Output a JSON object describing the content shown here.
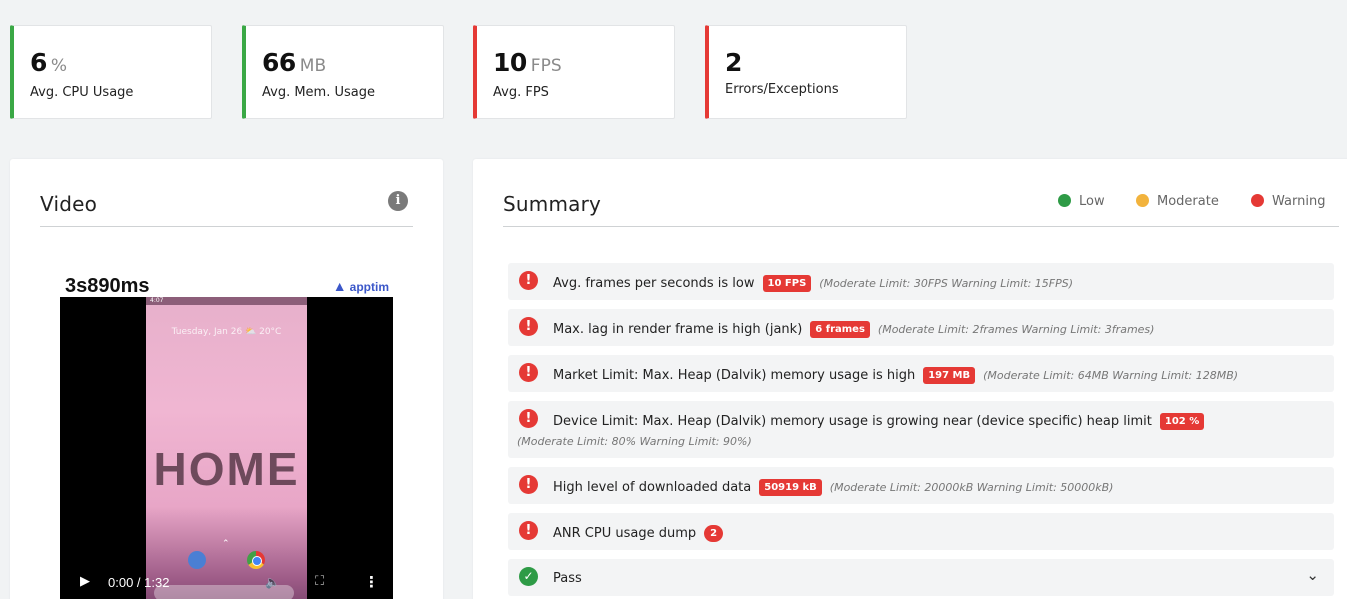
{
  "metrics": [
    {
      "value": "6",
      "unit": "%",
      "label": "Avg. CPU Usage",
      "status": "green"
    },
    {
      "value": "66",
      "unit": "MB",
      "label": "Avg. Mem. Usage",
      "status": "green"
    },
    {
      "value": "10",
      "unit": "FPS",
      "label": "Avg. FPS",
      "status": "red"
    },
    {
      "value": "2",
      "unit": "",
      "label": "Errors/Exceptions",
      "status": "red"
    }
  ],
  "video": {
    "title": "Video",
    "info_icon": "info-icon",
    "overlay_timer": "3s890ms",
    "brand": "apptim",
    "screen_text": "HOME",
    "date_text": "Tuesday, Jan 26 ⛅ 20°C",
    "status_time": "4:07",
    "time": "0:00 / 1:32"
  },
  "summary": {
    "title": "Summary",
    "legend": [
      {
        "label": "Low",
        "color": "#2e9b46"
      },
      {
        "label": "Moderate",
        "color": "#f2b33d"
      },
      {
        "label": "Warning",
        "color": "#e53935"
      }
    ],
    "items": [
      {
        "text": "Avg. frames per seconds is low",
        "badge": "10 FPS",
        "limit": "(Moderate Limit: 30FPS Warning Limit: 15FPS)"
      },
      {
        "text": "Max. lag in render frame is high (jank)",
        "badge": "6 frames",
        "limit": "(Moderate Limit: 2frames Warning Limit: 3frames)"
      },
      {
        "text": "Market Limit: Max. Heap (Dalvik) memory usage is high",
        "badge": "197 MB",
        "limit": "(Moderate Limit: 64MB Warning Limit: 128MB)"
      },
      {
        "text": "Device Limit: Max. Heap (Dalvik) memory usage is growing near (device specific) heap limit",
        "badge": "102 %",
        "limit": "(Moderate Limit: 80% Warning Limit: 90%)"
      },
      {
        "text": "High level of downloaded data",
        "badge": "50919 kB",
        "limit": "(Moderate Limit: 20000kB Warning Limit: 50000kB)"
      },
      {
        "text": "ANR CPU usage dump",
        "badge": "2",
        "limit": ""
      }
    ],
    "pass_label": "Pass"
  }
}
